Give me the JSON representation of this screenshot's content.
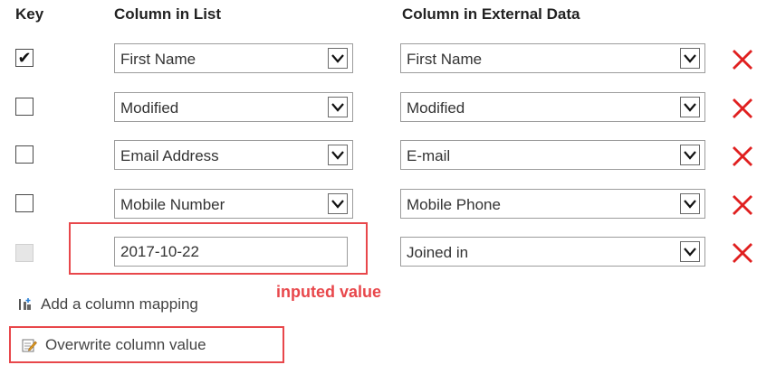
{
  "headers": {
    "key": "Key",
    "list": "Column in List",
    "external": "Column in External Data"
  },
  "rows": [
    {
      "key_checked": true,
      "list_value": "First Name",
      "external_value": "First Name"
    },
    {
      "key_checked": false,
      "list_value": "Modified",
      "external_value": "Modified"
    },
    {
      "key_checked": false,
      "list_value": "Email Address",
      "external_value": "E-mail"
    },
    {
      "key_checked": false,
      "list_value": "Mobile Number",
      "external_value": "Mobile Phone"
    },
    {
      "key_checked": false,
      "key_disabled": true,
      "list_input_value": "2017-10-22",
      "external_value": "Joined in"
    }
  ],
  "annotation": {
    "label": "inputed value",
    "color": "#e8474b"
  },
  "actions": {
    "add_mapping": "Add a column mapping",
    "overwrite": "Overwrite column value"
  },
  "icons": {
    "delete": "red-x-icon",
    "add": "add-column-icon",
    "overwrite": "edit-note-icon",
    "dropdown": "chevron-down-icon",
    "check": "checkmark-icon"
  }
}
